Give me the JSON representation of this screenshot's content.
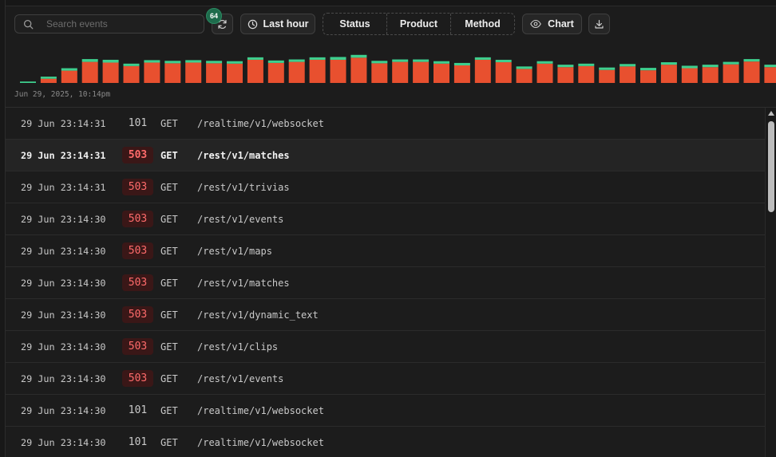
{
  "toolbar": {
    "search_placeholder": "Search events",
    "refresh_badge": "64",
    "time_range_label": "Last hour",
    "filters": [
      "Status",
      "Product",
      "Method"
    ],
    "chart_label": "Chart"
  },
  "colors": {
    "error": "#e8502f",
    "success": "#3ecf8e",
    "badge": "#1e6b4c"
  },
  "histogram": {
    "start_label": "Jun 29, 2025, 10:14pm",
    "bars": [
      {
        "error": 0.0,
        "success": 0.04
      },
      {
        "error": 0.12,
        "success": 0.06
      },
      {
        "error": 0.35,
        "success": 0.07
      },
      {
        "error": 0.6,
        "success": 0.08
      },
      {
        "error": 0.58,
        "success": 0.08
      },
      {
        "error": 0.48,
        "success": 0.07
      },
      {
        "error": 0.58,
        "success": 0.07
      },
      {
        "error": 0.56,
        "success": 0.07
      },
      {
        "error": 0.58,
        "success": 0.07
      },
      {
        "error": 0.56,
        "success": 0.07
      },
      {
        "error": 0.55,
        "success": 0.07
      },
      {
        "error": 0.66,
        "success": 0.07
      },
      {
        "error": 0.57,
        "success": 0.07
      },
      {
        "error": 0.6,
        "success": 0.07
      },
      {
        "error": 0.66,
        "success": 0.07
      },
      {
        "error": 0.66,
        "success": 0.08
      },
      {
        "error": 0.72,
        "success": 0.08
      },
      {
        "error": 0.56,
        "success": 0.07
      },
      {
        "error": 0.6,
        "success": 0.07
      },
      {
        "error": 0.6,
        "success": 0.07
      },
      {
        "error": 0.55,
        "success": 0.07
      },
      {
        "error": 0.5,
        "success": 0.07
      },
      {
        "error": 0.66,
        "success": 0.07
      },
      {
        "error": 0.59,
        "success": 0.07
      },
      {
        "error": 0.4,
        "success": 0.07
      },
      {
        "error": 0.55,
        "success": 0.07
      },
      {
        "error": 0.45,
        "success": 0.07
      },
      {
        "error": 0.48,
        "success": 0.07
      },
      {
        "error": 0.37,
        "success": 0.07
      },
      {
        "error": 0.47,
        "success": 0.07
      },
      {
        "error": 0.36,
        "success": 0.07
      },
      {
        "error": 0.52,
        "success": 0.07
      },
      {
        "error": 0.42,
        "success": 0.07
      },
      {
        "error": 0.45,
        "success": 0.07
      },
      {
        "error": 0.53,
        "success": 0.07
      },
      {
        "error": 0.61,
        "success": 0.07
      },
      {
        "error": 0.45,
        "success": 0.07
      }
    ]
  },
  "rows": [
    {
      "time": "29 Jun 23:14:31",
      "status": "101",
      "method": "GET",
      "path": "/realtime/v1/websocket",
      "error": false,
      "selected": false
    },
    {
      "time": "29 Jun 23:14:31",
      "status": "503",
      "method": "GET",
      "path": "/rest/v1/matches",
      "error": true,
      "selected": true
    },
    {
      "time": "29 Jun 23:14:31",
      "status": "503",
      "method": "GET",
      "path": "/rest/v1/trivias",
      "error": true,
      "selected": false
    },
    {
      "time": "29 Jun 23:14:30",
      "status": "503",
      "method": "GET",
      "path": "/rest/v1/events",
      "error": true,
      "selected": false
    },
    {
      "time": "29 Jun 23:14:30",
      "status": "503",
      "method": "GET",
      "path": "/rest/v1/maps",
      "error": true,
      "selected": false
    },
    {
      "time": "29 Jun 23:14:30",
      "status": "503",
      "method": "GET",
      "path": "/rest/v1/matches",
      "error": true,
      "selected": false
    },
    {
      "time": "29 Jun 23:14:30",
      "status": "503",
      "method": "GET",
      "path": "/rest/v1/dynamic_text",
      "error": true,
      "selected": false
    },
    {
      "time": "29 Jun 23:14:30",
      "status": "503",
      "method": "GET",
      "path": "/rest/v1/clips",
      "error": true,
      "selected": false
    },
    {
      "time": "29 Jun 23:14:30",
      "status": "503",
      "method": "GET",
      "path": "/rest/v1/events",
      "error": true,
      "selected": false
    },
    {
      "time": "29 Jun 23:14:30",
      "status": "101",
      "method": "GET",
      "path": "/realtime/v1/websocket",
      "error": false,
      "selected": false
    },
    {
      "time": "29 Jun 23:14:30",
      "status": "101",
      "method": "GET",
      "path": "/realtime/v1/websocket",
      "error": false,
      "selected": false
    }
  ]
}
